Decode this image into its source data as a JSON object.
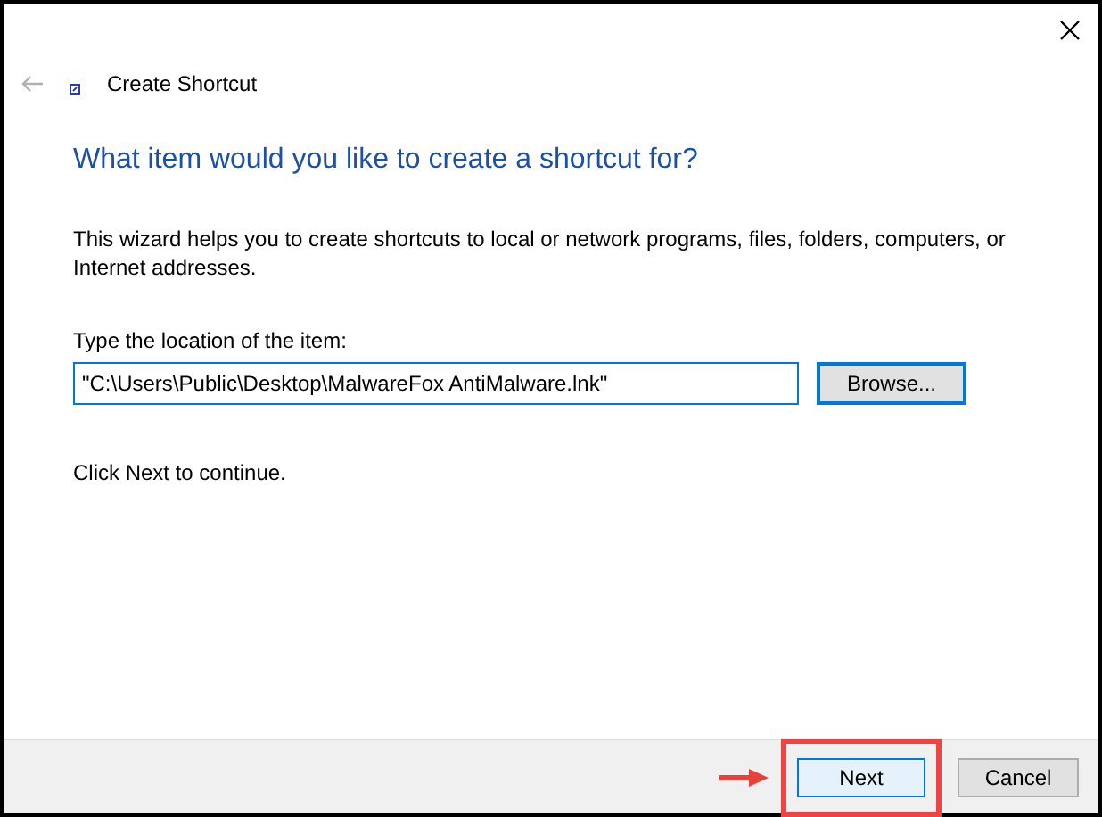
{
  "window": {
    "title": "Create Shortcut"
  },
  "heading": "What item would you like to create a shortcut for?",
  "description": "This wizard helps you to create shortcuts to local or network programs, files, folders, computers, or Internet addresses.",
  "location": {
    "label": "Type the location of the item:",
    "value": "\"C:\\Users\\Public\\Desktop\\MalwareFox AntiMalware.lnk\""
  },
  "browse_button": "Browse...",
  "hint": "Click Next to continue.",
  "buttons": [
    {
      "label": "Next",
      "highlighted": true,
      "default": true
    },
    {
      "label": "Cancel",
      "highlighted": false,
      "default": false
    }
  ]
}
